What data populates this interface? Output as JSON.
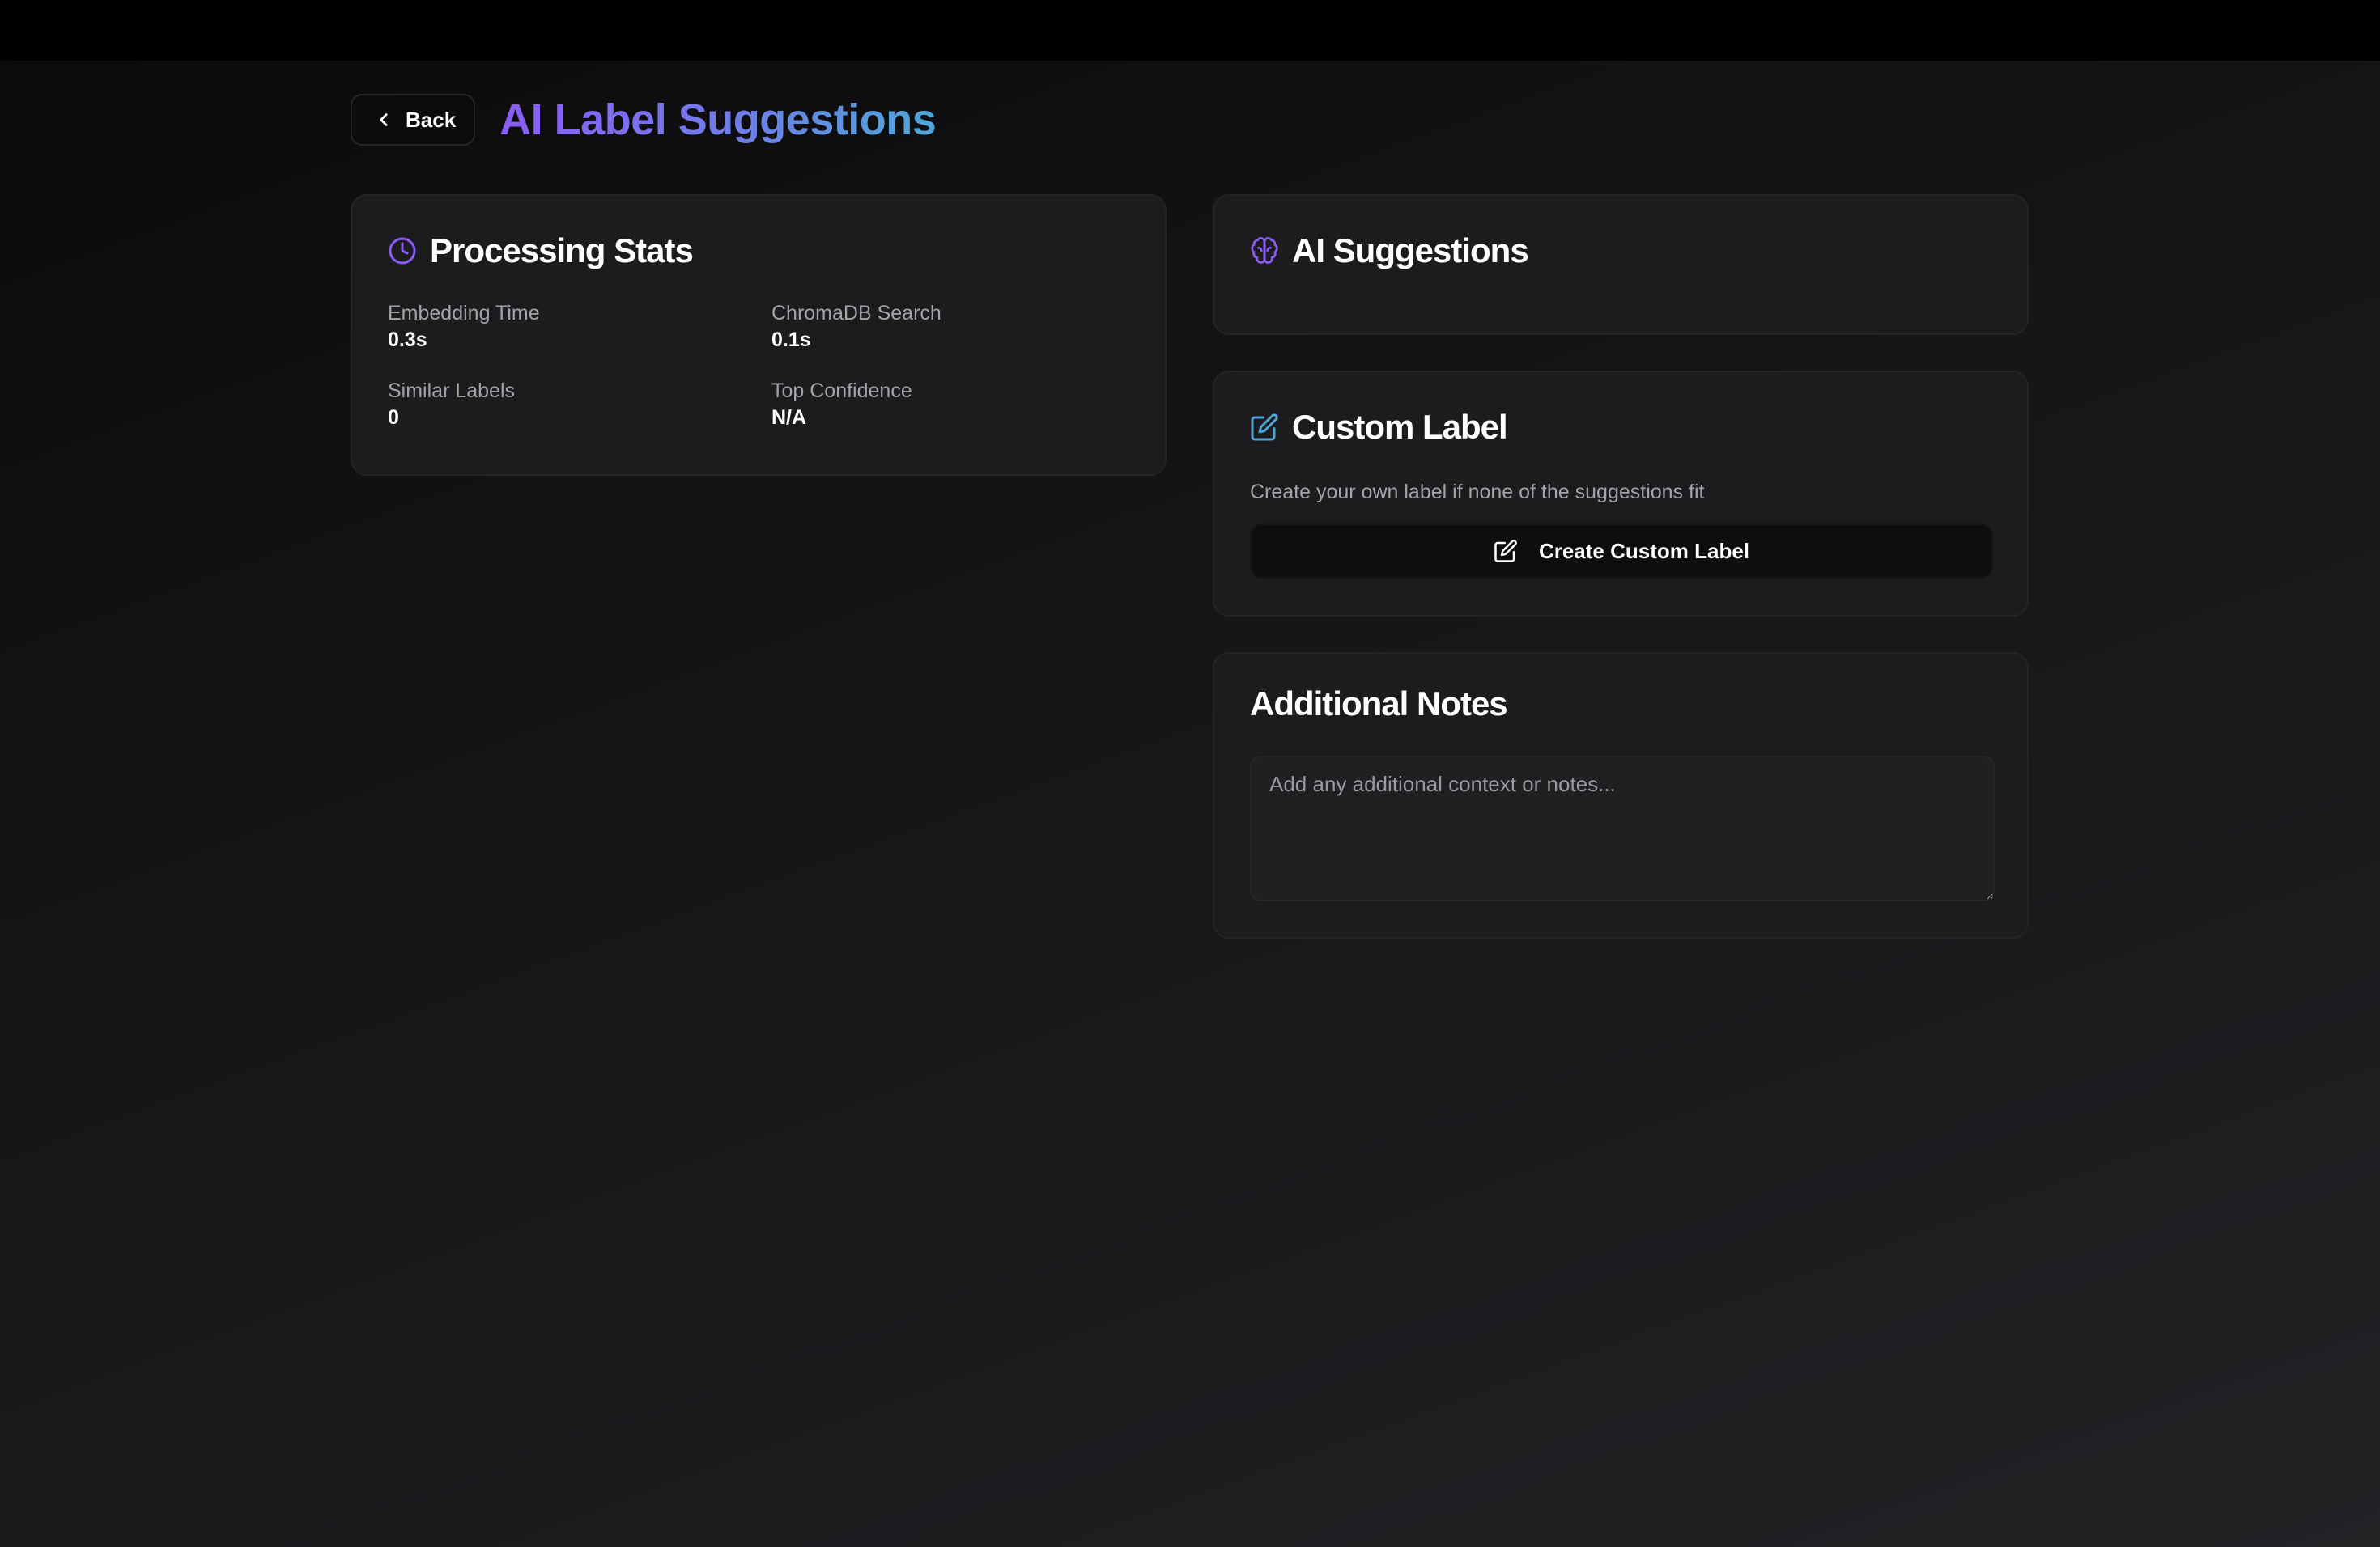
{
  "header": {
    "back_label": "Back",
    "title": "AI Label Suggestions",
    "title_gradient": [
      "#8b5cf6",
      "#4ea6d8"
    ]
  },
  "processing_stats": {
    "title": "Processing Stats",
    "icon": "clock-icon",
    "items": [
      {
        "label": "Embedding Time",
        "value": "0.3s"
      },
      {
        "label": "ChromaDB Search",
        "value": "0.1s"
      },
      {
        "label": "Similar Labels",
        "value": "0"
      },
      {
        "label": "Top Confidence",
        "value": "N/A"
      }
    ]
  },
  "ai_suggestions": {
    "title": "AI Suggestions",
    "icon": "brain-icon"
  },
  "custom_label": {
    "title": "Custom Label",
    "icon": "edit-icon",
    "description": "Create your own label if none of the suggestions fit",
    "button_label": "Create Custom Label"
  },
  "additional_notes": {
    "title": "Additional Notes",
    "placeholder": "Add any additional context or notes..."
  },
  "colors": {
    "accent_purple": "#8b5cf6",
    "accent_blue": "#4ea6d8",
    "card_bg": "#1c1c1f"
  }
}
